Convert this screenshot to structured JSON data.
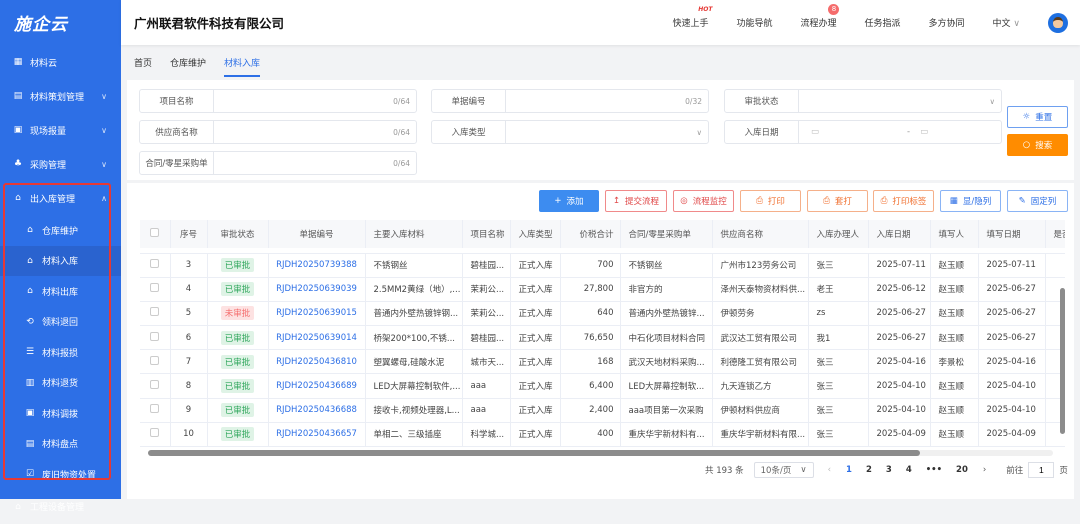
{
  "logo": "施企云",
  "sidebar": {
    "items": [
      {
        "label": "材料云",
        "icon": "grid-icon"
      },
      {
        "label": "材料策划管理",
        "icon": "doc-icon"
      },
      {
        "label": "现场报量",
        "icon": "report-icon"
      },
      {
        "label": "采购管理",
        "icon": "org-icon"
      },
      {
        "label": "出入库管理",
        "icon": "house-icon",
        "expanded": true
      }
    ],
    "sub": [
      {
        "label": "仓库维护"
      },
      {
        "label": "材料入库",
        "active": true
      },
      {
        "label": "材料出库"
      },
      {
        "label": "领料退回"
      },
      {
        "label": "材料报损"
      },
      {
        "label": "材料退货"
      },
      {
        "label": "材料调拨"
      },
      {
        "label": "材料盘点"
      },
      {
        "label": "废旧物资处置"
      }
    ],
    "next": "工程设备管理"
  },
  "header": {
    "company": "广州联君软件科技有限公司",
    "nav": [
      "快速上手",
      "功能导航",
      "流程办理",
      "任务指派",
      "多方协同"
    ],
    "hot": "HOT",
    "badge": "8",
    "lang": "中文"
  },
  "tabs": [
    "首页",
    "仓库维护",
    "材料入库"
  ],
  "filter": {
    "project": {
      "label": "项目名称",
      "count": "0/64"
    },
    "doc_no": {
      "label": "单据编号",
      "count": "0/32"
    },
    "status": {
      "label": "审批状态"
    },
    "supplier": {
      "label": "供应商名称",
      "count": "0/64"
    },
    "in_type": {
      "label": "入库类型"
    },
    "in_date": {
      "label": "入库日期",
      "sep": "-"
    },
    "contract": {
      "label": "合同/零星采购单",
      "count": "0/64"
    },
    "reset": "重置",
    "search": "搜索"
  },
  "toolbar": {
    "add": "添加",
    "submit": "提交流程",
    "monitor": "流程监控",
    "print": "打印",
    "set_print": "套打",
    "print_label": "打印标签",
    "toggle_cols": "显/隐列",
    "fix_cols": "固定列"
  },
  "colors": {
    "primary": "#2d6fe6",
    "orange": "#ff8c00",
    "danger": "#f56c6c",
    "success": "#2ea65a"
  },
  "table": {
    "headers": [
      "序号",
      "审批状态",
      "单据编号",
      "主要入库材料",
      "项目名称",
      "入库类型",
      "价税合计",
      "合同/零星采购单",
      "供应商名称",
      "入库办理人",
      "入库日期",
      "填写人",
      "填写日期",
      "是否已"
    ],
    "rows": [
      [
        "3",
        "已审批",
        "RJDH20250739388",
        "不锈钢丝",
        "碧桂园...",
        "正式入库",
        "700",
        "不锈钢丝",
        "广州市123劳务公司",
        "张三",
        "2025-07-11",
        "赵玉顺",
        "2025-07-11"
      ],
      [
        "4",
        "已审批",
        "RJDH20250639039",
        "2.5MM2黄绿（地）,...",
        "茉莉公...",
        "正式入库",
        "27,800",
        "非官方的",
        "泽州天泰物资材料供...",
        "老王",
        "2025-06-12",
        "赵玉顺",
        "2025-06-27"
      ],
      [
        "5",
        "未审批",
        "RJDH20250639015",
        "普通内外壁热镀锌钢...",
        "茉莉公...",
        "正式入库",
        "640",
        "普通内外壁热镀锌...",
        "伊顿劳务",
        "zs",
        "2025-06-27",
        "赵玉顺",
        "2025-06-27"
      ],
      [
        "6",
        "已审批",
        "RJDH20250639014",
        "桥架200*100,不锈...",
        "碧桂园...",
        "正式入库",
        "76,650",
        "中石化项目材料合同",
        "武汉达工贸有限公司",
        "我1",
        "2025-06-27",
        "赵玉顺",
        "2025-06-27"
      ],
      [
        "7",
        "已审批",
        "RJDH20250436810",
        "塑翼螺母,硅酸水泥",
        "城市天...",
        "正式入库",
        "168",
        "武汉天地材料采购...",
        "利德隆工贸有限公司",
        "张三",
        "2025-04-16",
        "李景松",
        "2025-04-16"
      ],
      [
        "8",
        "已审批",
        "RJDH20250436689",
        "LED大屏幕控制软件,...",
        "aaa",
        "正式入库",
        "6,400",
        "LED大屏幕控制软...",
        "九天连锁乙方",
        "张三",
        "2025-04-10",
        "赵玉顺",
        "2025-04-10"
      ],
      [
        "9",
        "已审批",
        "RJDH20250436688",
        "接收卡,视频处理器,L...",
        "aaa",
        "正式入库",
        "2,400",
        "aaa项目第一次采购",
        "伊顿材料供应商",
        "张三",
        "2025-04-10",
        "赵玉顺",
        "2025-04-10"
      ],
      [
        "10",
        "已审批",
        "RJDH20250436657",
        "单相二、三级插座",
        "科学城...",
        "正式入库",
        "400",
        "重庆华宇新材料有...",
        "重庆华宇新材料有限...",
        "张三",
        "2025-04-09",
        "赵玉顺",
        "2025-04-09"
      ]
    ]
  },
  "pagination": {
    "total": "共 193 条",
    "page_size": "10条/页",
    "pages": [
      "1",
      "2",
      "3",
      "4",
      "•••",
      "20"
    ],
    "current": "1",
    "goto_label": "前往",
    "goto_value": "1",
    "page_unit": "页"
  }
}
